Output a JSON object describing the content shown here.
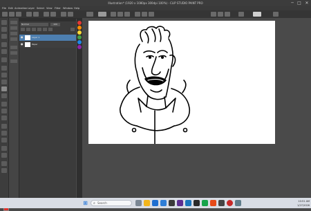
{
  "window": {
    "title": "Illustration* (1920 x 1080px 300dpi 100%) - CLIP STUDIO PAINT PRO",
    "minimize": "─",
    "maximize": "□",
    "close": "✕"
  },
  "menu": [
    "File",
    "Edit",
    "Animation",
    "Layer",
    "Select",
    "View",
    "Filter",
    "Window",
    "Help"
  ],
  "layer_panel": {
    "blend_mode": "Normal",
    "opacity": "100",
    "layers": [
      {
        "name": "Layer 1"
      },
      {
        "name": "Paper"
      }
    ]
  },
  "color_swatches": [
    "#e53935",
    "#fb8c00",
    "#fdd835",
    "#43a047",
    "#1e88e5",
    "#8e24aa"
  ],
  "taskbar": {
    "start_icon": "windows-start-icon",
    "search_placeholder": "Search",
    "time": "10:51 AM",
    "date": "1/27/2026"
  }
}
